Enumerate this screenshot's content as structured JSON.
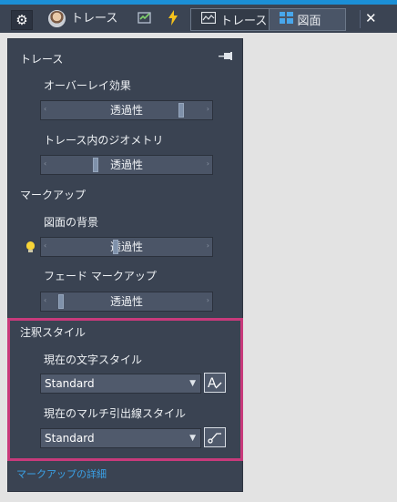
{
  "toolbar": {
    "user_label": "トレース",
    "toggle_trace_label": "トレース",
    "toggle_drawing_label": "図面"
  },
  "panel": {
    "trace_heading": "トレース",
    "overlay_label": "オーバーレイ効果",
    "overlay_slider": {
      "text": "透過性",
      "level": 0.85
    },
    "geometry_label": "トレース内のジオメトリ",
    "geometry_slider": {
      "text": "透過性",
      "level": 0.3
    },
    "markup_heading": "マークアップ",
    "background_label": "図面の背景",
    "background_slider": {
      "text": "透過性",
      "level": 0.43
    },
    "fade_label": "フェード マークアップ",
    "fade_slider": {
      "text": "透過性",
      "level": 0.08
    },
    "annotation_heading": "注釈スタイル",
    "text_style_label": "現在の文字スタイル",
    "text_style_value": "Standard",
    "mleader_style_label": "現在のマルチ引出線スタイル",
    "mleader_style_value": "Standard",
    "markup_details_link": "マークアップの詳細"
  },
  "colors": {
    "accent": "#1b8fd6",
    "panel_bg": "#3a4352",
    "highlight_frame": "#c83a7b",
    "link": "#3aa1e6",
    "bulb": "#f7d437"
  },
  "icons": [
    "gear-icon",
    "avatar",
    "checkmark-chart-icon",
    "lightning-icon",
    "trace-icon",
    "drawing-grid-icon",
    "close-icon",
    "pin-icon",
    "lightbulb-icon",
    "text-style-icon",
    "mleader-style-icon",
    "chevron-down-icon"
  ]
}
